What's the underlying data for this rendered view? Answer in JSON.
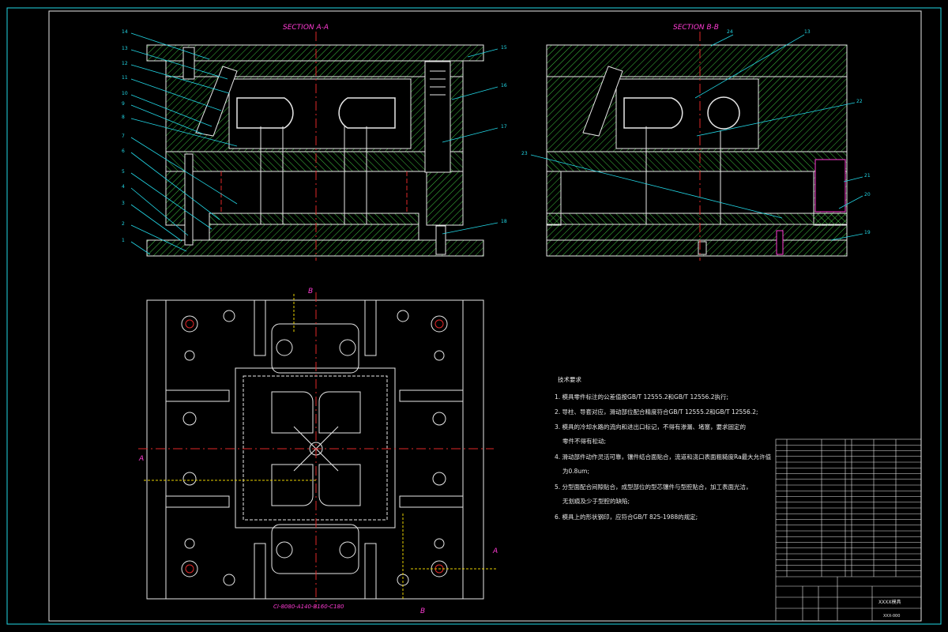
{
  "drawing": {
    "section_a_title": "SECTION A-A",
    "section_b_title": "SECTION B-B",
    "section_marks": {
      "a_left": "A",
      "a_right": "A",
      "b_top": "B",
      "b_bottom": "B"
    },
    "mold_base_code": "CI-8080-A140-B160-C180",
    "callouts_a": [
      "14",
      "13",
      "12",
      "11",
      "10",
      "9",
      "8",
      "7",
      "6",
      "5",
      "4",
      "3",
      "2",
      "1",
      "15",
      "16",
      "17",
      "18"
    ],
    "callouts_b": [
      "24",
      "13",
      "22",
      "23",
      "21",
      "20",
      "19"
    ]
  },
  "technical_requirements": {
    "heading": "技术要求",
    "items": [
      "1. 模具零件标注的公差值按GB/T 12555.2和GB/T 12556.2执行;",
      "2. 导柱、导套对应，滑动部位配合精度符合GB/T 12555.2和GB/T 12556.2;",
      "3. 模具的冷却水路的流向和进出口标记，不得有渗漏、堵塞，要求固定的",
      "零件不得有松动;",
      "4. 滑动部件动作灵活可靠，镶件结合面贴合，流道和浇口表面粗糙度Ra最大允许值",
      "为0.8um;",
      "5. 分型面配合间隙贴合，成型部位的型芯镶件与型腔贴合，加工表面光洁，",
      "无划痕及少于型腔的缺陷;",
      "6. 模具上的形状钢印，应符合GB/T 825-1988的规定;"
    ]
  },
  "title_block": {
    "drawing_name": "XXXX模具",
    "drawing_no": "XXX-000"
  },
  "colors": {
    "background": "#000000",
    "outline": "#e8e8e8",
    "hatch": "#3fbf3f",
    "leader": "#22d7e6",
    "centerline": "#e02828",
    "accent": "#ff3bd4",
    "section_line": "#e8d000"
  }
}
